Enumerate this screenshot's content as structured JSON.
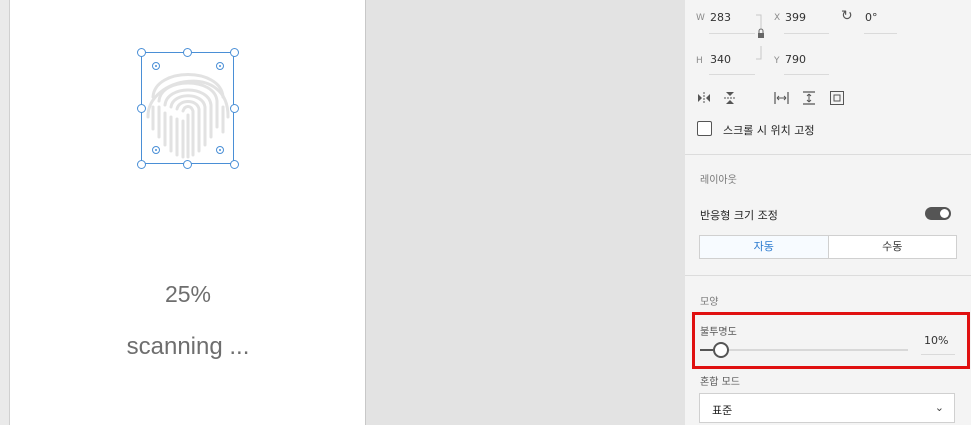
{
  "artboard": {
    "progress_text": "25%",
    "status_text": "scanning ..."
  },
  "transform": {
    "w_label": "W",
    "w_value": "283",
    "x_label": "X",
    "x_value": "399",
    "h_label": "H",
    "h_value": "340",
    "y_label": "Y",
    "y_value": "790",
    "rotation_value": "0°",
    "fix_on_scroll_label": "스크롤 시 위치 고정"
  },
  "layout": {
    "title": "레이아웃",
    "responsive_resize_label": "반응형 크기 조정",
    "responsive_resize_on": true,
    "modes": [
      "자동",
      "수동"
    ],
    "active_mode": "자동"
  },
  "appearance": {
    "title": "모양",
    "opacity_label": "불투명도",
    "opacity_value": "10%",
    "opacity_fraction": 0.1,
    "blend_label": "혼합 모드",
    "blend_value": "표준"
  },
  "colors": {
    "accent": "#2c7bd0",
    "selection": "#4a8fd6",
    "highlight": "#e01010"
  }
}
